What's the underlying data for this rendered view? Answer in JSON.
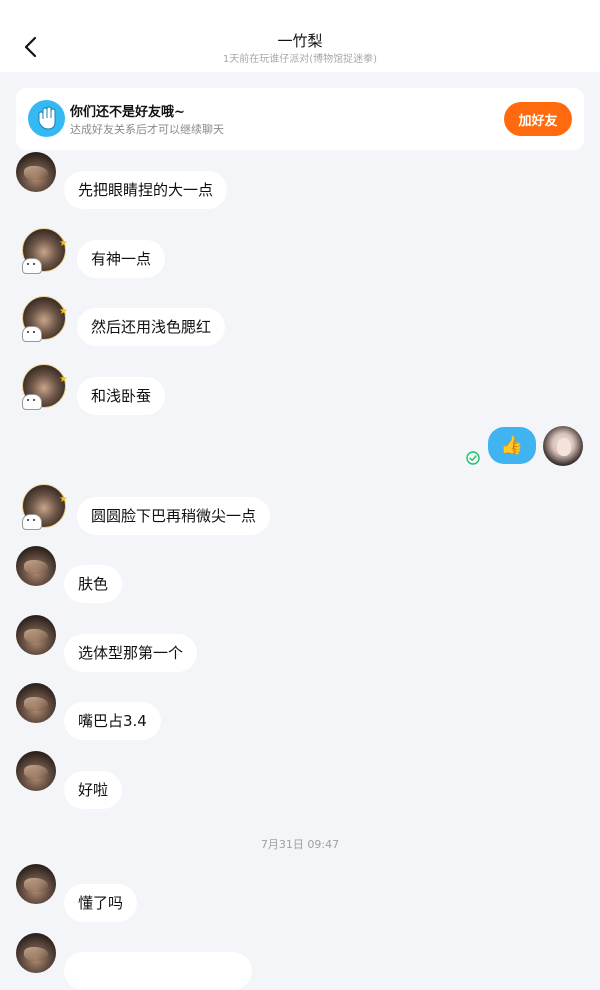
{
  "header": {
    "title": "一竹梨",
    "subtitle": "1天前在玩谁仔派对(博物馆捉迷拳)"
  },
  "banner": {
    "title": "你们还不是好友哦~",
    "subtitle": "达成好友关系后才可以继续聊天",
    "add_button": "加好友"
  },
  "messages": [
    {
      "text": "先把眼睛捏的大一点"
    },
    {
      "text": "有神一点"
    },
    {
      "text": "然后还用浅色腮红"
    },
    {
      "text": "和浅卧蚕"
    },
    {
      "text": "👍",
      "self": true
    },
    {
      "text": "圆圆脸下巴再稍微尖一点"
    },
    {
      "text": "肤色"
    },
    {
      "text": "选体型那第一个"
    },
    {
      "text": "嘴巴占3.4"
    },
    {
      "text": "好啦"
    },
    {
      "text": "懂了吗"
    }
  ],
  "timestamp": "7月31日 09:47",
  "colors": {
    "accent_orange": "#ff6a0f",
    "self_bubble_blue": "#3fb4f0",
    "background": "#f4f5f8"
  },
  "icons": [
    "back-arrow-icon",
    "hand-wave-icon",
    "thumbs-up-icon",
    "sent-check-icon"
  ]
}
